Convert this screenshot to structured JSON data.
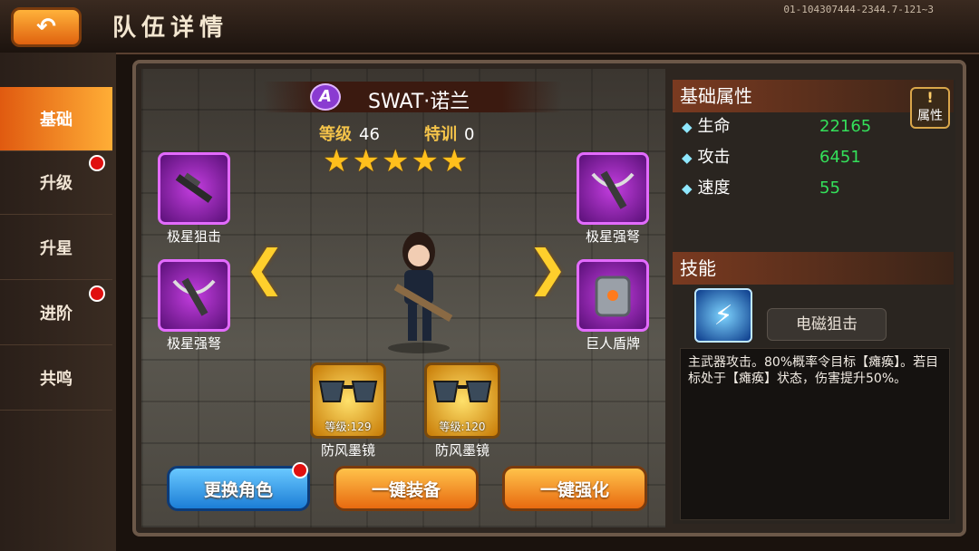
{
  "header": {
    "title": "队伍详情",
    "version": "01-104307444-2344.7-121~3"
  },
  "sidebar": {
    "items": [
      {
        "label": "基础",
        "active": true,
        "badge": false
      },
      {
        "label": "升级",
        "active": false,
        "badge": true
      },
      {
        "label": "升星",
        "active": false,
        "badge": false
      },
      {
        "label": "进阶",
        "active": false,
        "badge": true
      },
      {
        "label": "共鸣",
        "active": false,
        "badge": false
      }
    ]
  },
  "hero": {
    "rank": "A",
    "name": "SWAT·诺兰",
    "level_label": "等级",
    "level": "46",
    "training_label": "特训",
    "training": "0",
    "stars": 5
  },
  "equipment": {
    "left_top": "极星狙击",
    "left_bottom": "极星强弩",
    "right_top": "极星强弩",
    "right_bottom": "巨人盾牌"
  },
  "accessories": [
    {
      "level_text": "等级:129",
      "name": "防风墨镜"
    },
    {
      "level_text": "等级:120",
      "name": "防风墨镜"
    }
  ],
  "buttons": {
    "change_character": "更换角色",
    "one_click_equip": "一键装备",
    "one_click_enhance": "一键强化"
  },
  "attributes": {
    "heading": "基础属性",
    "button_label": "属性",
    "rows": [
      {
        "name": "生命",
        "value": "22165"
      },
      {
        "name": "攻击",
        "value": "6451"
      },
      {
        "name": "速度",
        "value": "55"
      }
    ]
  },
  "skill": {
    "heading": "技能",
    "name": "电磁狙击",
    "description": "主武器攻击。80%概率令目标【瘫痪】。若目标处于【瘫痪】状态，伤害提升50%。"
  },
  "colors": {
    "accent_orange": "#e86a10",
    "attr_value_green": "#34e05a",
    "equip_purple": "#c43ee0"
  }
}
